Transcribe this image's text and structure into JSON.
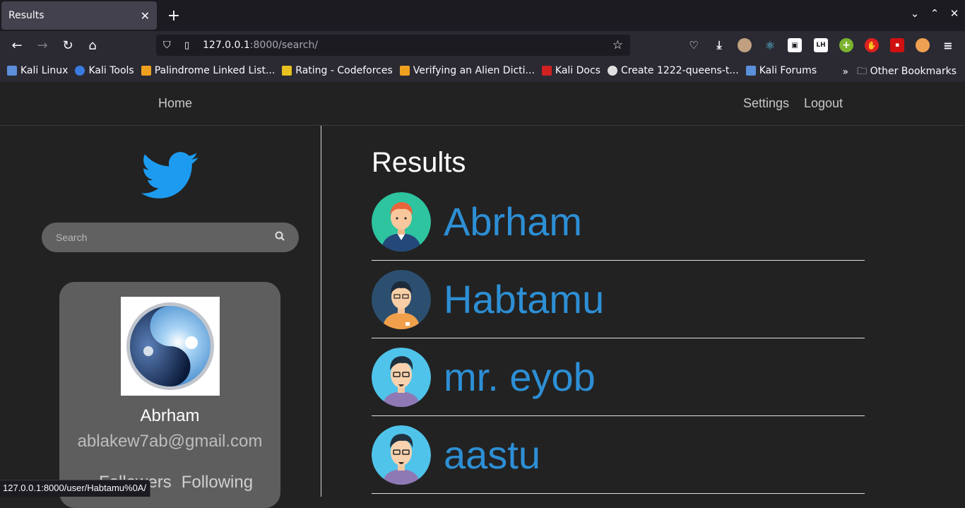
{
  "browser": {
    "tab_title": "Results",
    "tab_close": "✕",
    "new_tab": "+",
    "url_host": "127.0.0.1",
    "url_path": ":8000/search/",
    "bookmarks": [
      {
        "label": "Kali Linux",
        "color": "#5b8fd9"
      },
      {
        "label": "Kali Tools",
        "color": "#3a7be0"
      },
      {
        "label": "Palindrome Linked List...",
        "color": "#f0a020"
      },
      {
        "label": "Rating - Codeforces",
        "color": "#e8c020"
      },
      {
        "label": "Verifying an Alien Dicti...",
        "color": "#f0a020"
      },
      {
        "label": "Kali Docs",
        "color": "#d02020"
      },
      {
        "label": "Create 1222-queens-t...",
        "color": "#e0e0e0"
      },
      {
        "label": "Kali Forums",
        "color": "#5b8fd9"
      }
    ],
    "other_bookmarks": "Other Bookmarks",
    "status_url": "127.0.0.1:8000/user/Habtamu%0A/"
  },
  "nav": {
    "home": "Home",
    "settings": "Settings",
    "logout": "Logout"
  },
  "search": {
    "placeholder": "Search"
  },
  "profile": {
    "name": "Abrham",
    "email": "ablakew7ab@gmail.com",
    "followers": "Followers",
    "following": "Following"
  },
  "results": {
    "title": "Results",
    "users": [
      {
        "name": "Abrham"
      },
      {
        "name": "Habtamu"
      },
      {
        "name": "mr. eyob"
      },
      {
        "name": "aastu"
      }
    ]
  },
  "colors": {
    "link": "#2d8fd5",
    "twitter_blue": "#1d9bf0",
    "page_bg": "#222222"
  }
}
